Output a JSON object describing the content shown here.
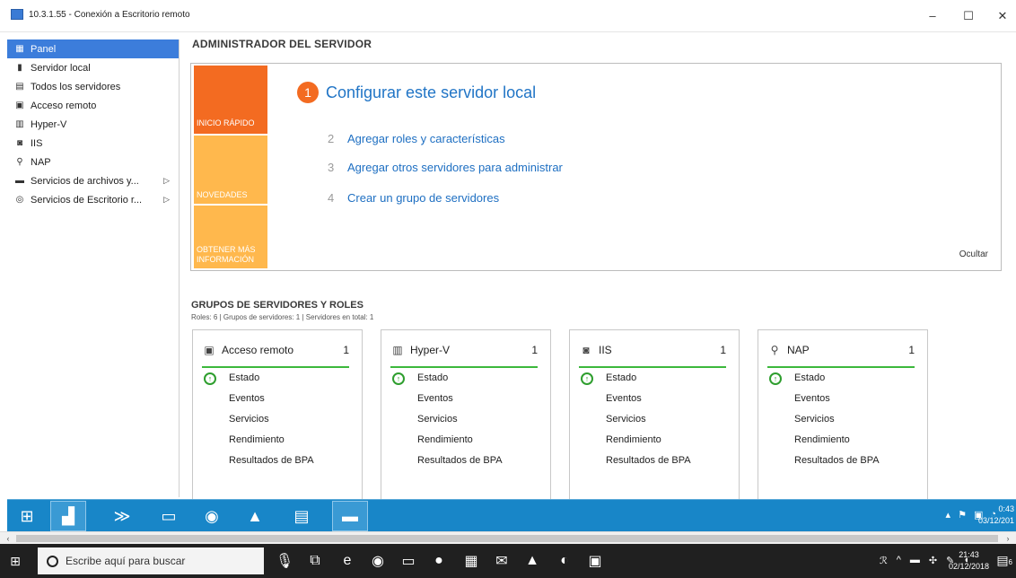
{
  "window": {
    "title": "10.3.1.55 - Conexión a Escritorio remoto",
    "minimize": "–",
    "maximize": "☐",
    "close": "✕"
  },
  "sidebar": {
    "items": [
      {
        "label": "Panel",
        "icon": "dashboard-icon"
      },
      {
        "label": "Servidor local",
        "icon": "server-icon"
      },
      {
        "label": "Todos los servidores",
        "icon": "servers-icon"
      },
      {
        "label": "Acceso remoto",
        "icon": "remote-access-icon"
      },
      {
        "label": "Hyper-V",
        "icon": "hyperv-icon"
      },
      {
        "label": "IIS",
        "icon": "iis-icon"
      },
      {
        "label": "NAP",
        "icon": "nap-icon"
      },
      {
        "label": "Servicios de archivos y...",
        "icon": "file-services-icon"
      },
      {
        "label": "Servicios de Escritorio r...",
        "icon": "remote-desktop-icon"
      }
    ]
  },
  "main": {
    "title": "ADMINISTRADOR DEL SERVIDOR",
    "quickstart": {
      "tiles": [
        "INICIO RÁPIDO",
        "NOVEDADES",
        "OBTENER MÁS INFORMACIÓN"
      ],
      "main_step": {
        "num": "1",
        "label": "Configurar este servidor local"
      },
      "steps": [
        {
          "num": "2",
          "label": "Agregar roles y características"
        },
        {
          "num": "3",
          "label": "Agregar otros servidores para administrar"
        },
        {
          "num": "4",
          "label": "Crear un grupo de servidores"
        }
      ],
      "hide": "Ocultar"
    },
    "groups": {
      "title": "GRUPOS DE SERVIDORES Y ROLES",
      "subtitle": "Roles: 6   |   Grupos de servidores: 1   |   Servidores en total: 1",
      "cards": [
        {
          "name": "Acceso remoto",
          "count": "1",
          "icon": "remote-access-icon"
        },
        {
          "name": "Hyper-V",
          "count": "1",
          "icon": "hyperv-icon"
        },
        {
          "name": "IIS",
          "count": "1",
          "icon": "iis-icon"
        },
        {
          "name": "NAP",
          "count": "1",
          "icon": "nap-icon"
        }
      ],
      "rows": [
        "Estado",
        "Eventos",
        "Servicios",
        "Rendimiento",
        "Resultados de BPA"
      ]
    }
  },
  "remote_taskbar": {
    "clock_time": "0:43",
    "clock_date": "03/12/201"
  },
  "host_taskbar": {
    "search_placeholder": "Escribe aquí para buscar",
    "clock_time": "21:43",
    "clock_date": "02/12/2018",
    "notification_count": "6"
  },
  "colors": {
    "accent_blue": "#3c7ddb",
    "orange": "#f36b21",
    "light_orange": "#ffb84d",
    "status_green": "#3cb83c",
    "remote_taskbar": "#1886c8"
  }
}
